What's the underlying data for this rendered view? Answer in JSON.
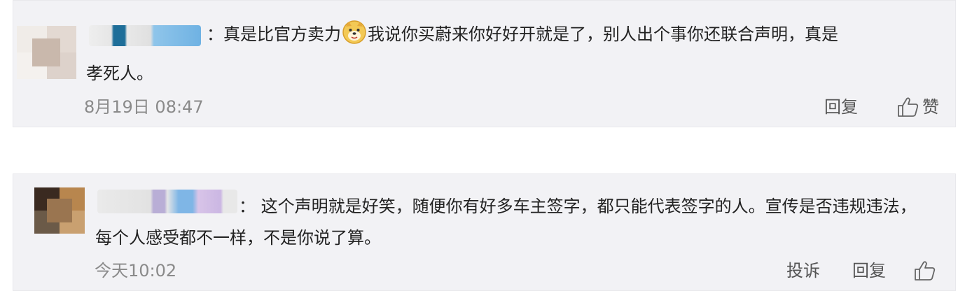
{
  "comments": [
    {
      "text_line1_a": "：真是比官方卖力",
      "emoji": "doge-emoji",
      "text_line1_b": "我说你买蔚来你好好开就是了，别人出个事你还联合声明，真是",
      "text_line2": "孝死人。",
      "time": "8月19日 08:47",
      "reply_label": "回复",
      "like_label": "赞",
      "icons": {
        "like": "thumbs-up-icon"
      }
    },
    {
      "text_line1": "：  这个声明就是好笑，随便你有好多车主签字，都只能代表签字的人。宣传是否违规违法，",
      "text_line2": "每个人感受都不一样，不是你说了算。",
      "time": "今天10:02",
      "report_label": "投诉",
      "reply_label": "回复",
      "icons": {
        "like": "thumbs-up-icon"
      }
    }
  ],
  "colors": {
    "card_bg": "#f2f2f5",
    "text": "#222222",
    "meta": "#8a8a8a",
    "action": "#555555"
  }
}
